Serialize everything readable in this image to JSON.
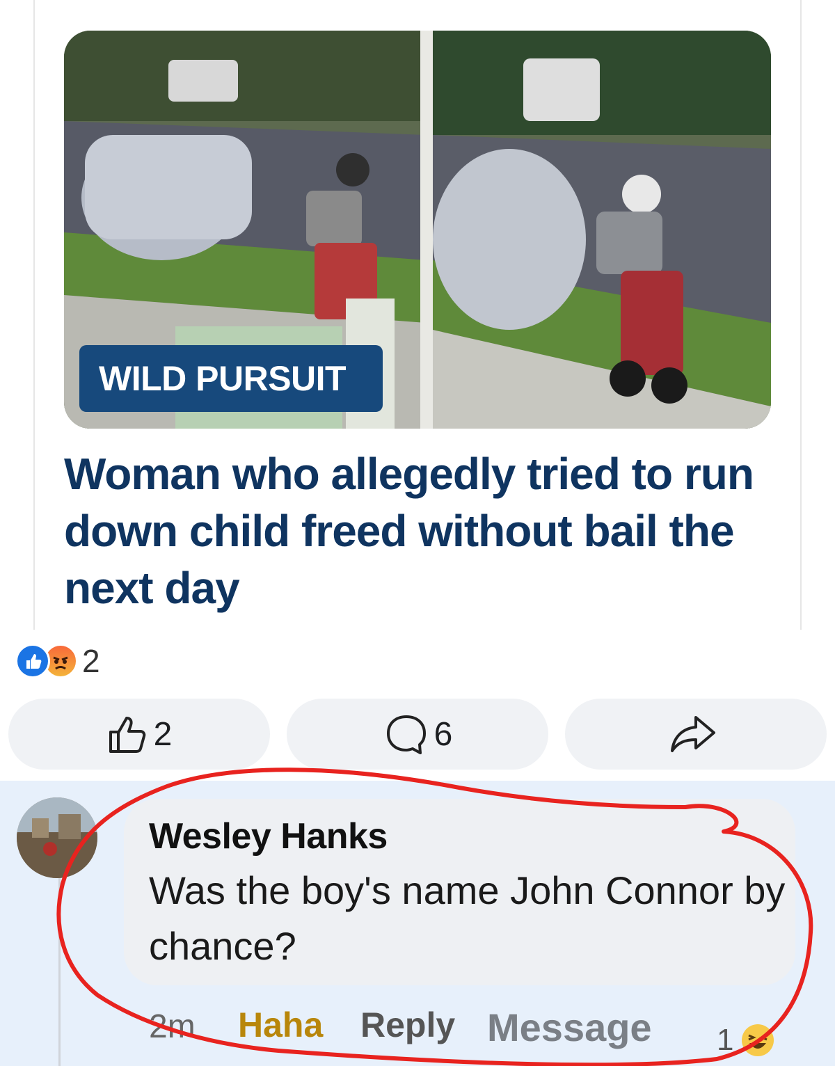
{
  "post": {
    "badge": "WILD PURSUIT",
    "headline": "Woman who allegedly tried to run down child freed without bail the next day"
  },
  "reactions": {
    "icons": [
      "like-icon",
      "angry-icon"
    ],
    "count": "2"
  },
  "actions": {
    "like_count": "2",
    "comment_count": "6",
    "share": ""
  },
  "comment": {
    "author": "Wesley Hanks",
    "text": "Was the boy's name John Connor by chance?",
    "time": "2m",
    "reaction_label": "Haha",
    "reply_label": "Reply",
    "message_label": "Message",
    "reaction_count": "1"
  },
  "colors": {
    "headline": "#0f3460",
    "badge": "#17497c",
    "annotation": "#e8231f",
    "comment_bg": "#e7f0fb"
  }
}
